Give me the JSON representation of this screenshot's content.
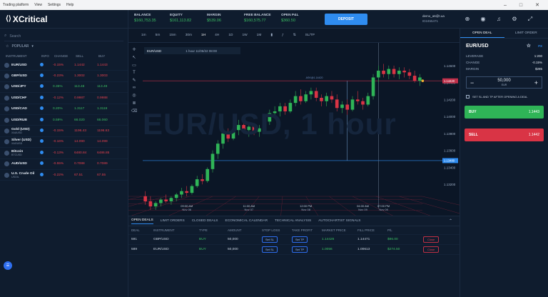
{
  "os": {
    "menu": [
      "Trading platform",
      "View",
      "Settings",
      "Help"
    ],
    "controls": [
      "–",
      "□",
      "✕"
    ]
  },
  "logo": {
    "text": "XCritical"
  },
  "search": {
    "placeholder": "Search"
  },
  "watchlist": {
    "group": "POPULAR",
    "headers": [
      "INSTRUMENT",
      "INFO",
      "CHANGE",
      "SELL",
      "BUY"
    ],
    "rows": [
      {
        "name": "EUR/USD",
        "sub": "",
        "change": "-0.15%",
        "sell": "1.1442",
        "buy": "1.1443",
        "dir": "neg"
      },
      {
        "name": "GBP/USD",
        "sub": "",
        "change": "-0.23%",
        "sell": "1.3002",
        "buy": "1.3003",
        "dir": "neg"
      },
      {
        "name": "USD/JPY",
        "sub": "",
        "change": "0.35%",
        "sell": "113.48",
        "buy": "113.49",
        "dir": "pos"
      },
      {
        "name": "USD/CHF",
        "sub": "",
        "change": "-0.12%",
        "sell": "0.9987",
        "buy": "0.9988",
        "dir": "neg"
      },
      {
        "name": "USD/CAD",
        "sub": "",
        "change": "0.20%",
        "sell": "1.3117",
        "buy": "1.3119",
        "dir": "pos"
      },
      {
        "name": "USD/RUB",
        "sub": "",
        "change": "0.59%",
        "sell": "66.020",
        "buy": "66.060",
        "dir": "pos"
      },
      {
        "name": "Gold (USD)",
        "sub": "XAUUSD",
        "change": "-0.15%",
        "sell": "1196.43",
        "buy": "1196.63",
        "dir": "neg"
      },
      {
        "name": "Silver (USD)",
        "sub": "XAGUSD",
        "change": "-0.16%",
        "sell": "14.090",
        "buy": "14.099",
        "dir": "neg"
      },
      {
        "name": "Bitcoin",
        "sub": "BTCUSD",
        "change": "-0.13%",
        "sell": "6480.84",
        "buy": "6486.85",
        "dir": "neg"
      },
      {
        "name": "AUD/USD",
        "sub": "",
        "change": "-0.55%",
        "sell": "0.7088",
        "buy": "0.7089",
        "dir": "neg"
      },
      {
        "name": "U.S. Crude Oil",
        "sub": "USOIL",
        "change": "-0.22%",
        "sell": "67.51",
        "buy": "67.55",
        "dir": "neg"
      }
    ]
  },
  "topbar": {
    "balance_label": "BALANCE",
    "balance": "$160,753.35",
    "equity_label": "EQUITY",
    "equity": "$161,113.82",
    "margin_label": "MARGIN",
    "margin": "$539.06",
    "free_label": "FREE BALANCE",
    "free": "$160,575.77",
    "openpl_label": "OPEN P&L",
    "openpl": "$360.50",
    "deposit": "DEPOSIT",
    "account": "demo_a6@t.ua",
    "account_id": "ID2455471"
  },
  "chart_toolbar": {
    "timeframes": [
      "1m",
      "5m",
      "15m",
      "30m",
      "1H",
      "4H",
      "1D",
      "1W",
      "1M"
    ],
    "active": "1H",
    "extra": [
      "SL/TP"
    ]
  },
  "chart": {
    "symbol": "EUR/USD",
    "interval": "1 hour",
    "head_rest": "1 hour  11/05/22  08:00",
    "watermark": "EUR/USD, 1 hour"
  },
  "chart_data": {
    "type": "candlestick",
    "ohlc": [
      [
        1.1306,
        1.1312,
        1.1296,
        1.13
      ],
      [
        1.13,
        1.1306,
        1.129,
        1.1294
      ],
      [
        1.1294,
        1.13,
        1.129,
        1.1298
      ],
      [
        1.1298,
        1.1304,
        1.1294,
        1.1302
      ],
      [
        1.1302,
        1.1308,
        1.1298,
        1.13
      ],
      [
        1.13,
        1.1306,
        1.1296,
        1.1304
      ],
      [
        1.1304,
        1.131,
        1.13,
        1.1308
      ],
      [
        1.1308,
        1.1316,
        1.1304,
        1.1312
      ],
      [
        1.1312,
        1.1318,
        1.1306,
        1.131
      ],
      [
        1.131,
        1.132,
        1.1308,
        1.1318
      ],
      [
        1.1318,
        1.133,
        1.1316,
        1.1326
      ],
      [
        1.1326,
        1.1332,
        1.132,
        1.1324
      ],
      [
        1.1324,
        1.134,
        1.1322,
        1.1338
      ],
      [
        1.1338,
        1.136,
        1.1334,
        1.1356
      ],
      [
        1.1356,
        1.1372,
        1.135,
        1.1368
      ],
      [
        1.1368,
        1.1384,
        1.1362,
        1.138
      ],
      [
        1.138,
        1.1386,
        1.137,
        1.1374
      ],
      [
        1.1374,
        1.1388,
        1.1372,
        1.1384
      ],
      [
        1.1384,
        1.1396,
        1.1378,
        1.139
      ],
      [
        1.139,
        1.1394,
        1.138,
        1.1384
      ],
      [
        1.1384,
        1.1392,
        1.1376,
        1.1388
      ],
      [
        1.1388,
        1.1392,
        1.1378,
        1.1382
      ],
      [
        1.1382,
        1.139,
        1.1376,
        1.1386
      ],
      [
        1.1386,
        1.1398,
        1.1384,
        1.1394
      ],
      [
        1.1394,
        1.1408,
        1.139,
        1.1404
      ],
      [
        1.1404,
        1.1412,
        1.1398,
        1.1406
      ],
      [
        1.1406,
        1.1416,
        1.14,
        1.1412
      ],
      [
        1.1412,
        1.1416,
        1.1402,
        1.1406
      ],
      [
        1.1406,
        1.142,
        1.1404,
        1.1416
      ],
      [
        1.1416,
        1.143,
        1.1412,
        1.1424
      ],
      [
        1.1424,
        1.1432,
        1.1414,
        1.1418
      ],
      [
        1.1418,
        1.143,
        1.1416,
        1.1426
      ],
      [
        1.1426,
        1.1434,
        1.142,
        1.143
      ],
      [
        1.143,
        1.1434,
        1.1418,
        1.1422
      ],
      [
        1.1422,
        1.1426,
        1.1412,
        1.1418
      ],
      [
        1.1418,
        1.1428,
        1.1412,
        1.1424
      ],
      [
        1.1424,
        1.143,
        1.1416,
        1.142
      ],
      [
        1.142,
        1.1426,
        1.1406,
        1.141
      ],
      [
        1.141,
        1.1418,
        1.1404,
        1.1414
      ],
      [
        1.1414,
        1.142,
        1.1402,
        1.1408
      ],
      [
        1.1408,
        1.1424,
        1.1406,
        1.142
      ],
      [
        1.142,
        1.143,
        1.1414,
        1.1418
      ],
      [
        1.1418,
        1.1422,
        1.1408,
        1.1414
      ],
      [
        1.1414,
        1.1428,
        1.1412,
        1.1424
      ],
      [
        1.1424,
        1.145,
        1.142,
        1.1446
      ],
      [
        1.1446,
        1.146,
        1.144,
        1.1454
      ],
      [
        1.1454,
        1.1462,
        1.1446,
        1.145
      ],
      [
        1.145,
        1.146,
        1.1444,
        1.1456
      ],
      [
        1.1456,
        1.146,
        1.1446,
        1.145
      ],
      [
        1.145,
        1.1458,
        1.1444,
        1.1454
      ],
      [
        1.1454,
        1.1458,
        1.1446,
        1.1452
      ],
      [
        1.1452,
        1.1456,
        1.1444,
        1.1448
      ],
      [
        1.1448,
        1.1454,
        1.144,
        1.1442
      ],
      [
        1.1442,
        1.145,
        1.1436,
        1.1446
      ]
    ],
    "price_line": 1.1442,
    "lower_line": 1.1348,
    "y_ticks": [
      1.146,
      1.144,
      1.142,
      1.14,
      1.138,
      1.136,
      1.134,
      1.132
    ],
    "y_tick_labels": [
      "1.14600",
      "1.14400",
      "1.14200",
      "1.14000",
      "1.13800",
      "1.13600",
      "1.13400",
      "1.13200"
    ],
    "ylim": [
      1.13,
      1.1475
    ],
    "x_tick_labels": [
      "09:00 AM\nNov 06",
      "11:00 AM\nNov 07",
      "12:00 PM\nNov 08",
      "04:00 AM\nNov 09",
      "07:00 PM\nNov 09"
    ],
    "x_tick_index": [
      8,
      20,
      31,
      42,
      46
    ],
    "current_label": "1.14420",
    "lower_label": "1.13480",
    "marker_label": "ASK@1.14420"
  },
  "bottom": {
    "tabs": [
      "OPEN DEALS",
      "LIMIT ORDERS",
      "CLOSED DEALS",
      "ECONOMICAL CALENDAR",
      "TECHNICAL ANALYSIS",
      "AUTOCHARTIST SIGNALS"
    ],
    "headers": [
      "DEAL",
      "INSTRUMENT",
      "TYPE",
      "AMOUNT",
      "STOP LOSS",
      "TAKE PROFIT",
      "MARKET PRICE",
      "FILL PRICE",
      "P/L",
      ""
    ],
    "rows": [
      {
        "deal": "591",
        "instrument": "GBP/USD",
        "type": "BUY",
        "amount": "50,000",
        "sl": "Set SL",
        "tp": "Set TP",
        "market": "1.14426",
        "fill": "1.14471",
        "pl": "$86.00",
        "close": "Close"
      },
      {
        "deal": "589",
        "instrument": "EUR/USD",
        "type": "BUY",
        "amount": "50,000",
        "sl": "Set SL",
        "tp": "Set TP",
        "market": "1.0056",
        "fill": "1.00613",
        "pl": "$274.50",
        "close": "Close"
      }
    ]
  },
  "right": {
    "tabs": [
      "OPEN DEAL",
      "LIMIT ORDER"
    ],
    "pair": "EUR/USD",
    "leverage_label": "LEVERAGE",
    "leverage": "1:200",
    "change_label": "CHANGE",
    "change": "-0.15%",
    "margin_label": "MARGIN",
    "margin": "$285",
    "amount": "50,000",
    "currency": "EUR",
    "sltp": "SET SL AND TP AFTER OPENING A DEAL",
    "buy": "BUY",
    "buy_price": "1.1443",
    "sell": "SELL",
    "sell_price": "1.1442",
    "fx": "FX"
  },
  "colors": {
    "bull": "#2fb457",
    "bear": "#d93445",
    "accent": "#2f8cf0",
    "priceLine": "#c0304a",
    "lowerLine": "#2f8cf0"
  }
}
